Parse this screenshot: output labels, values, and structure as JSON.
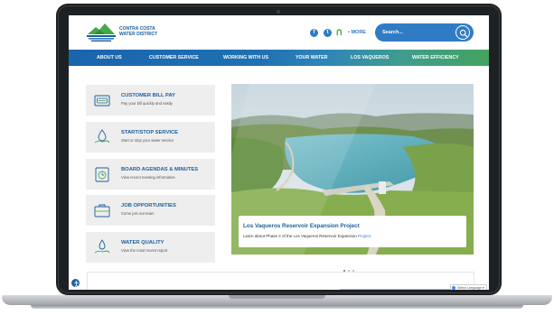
{
  "header": {
    "logo_line1": "CONTRA COSTA",
    "logo_line2": "WATER DISTRICT",
    "more_label": "• MORE",
    "search_placeholder": "Search..."
  },
  "nav": {
    "items": [
      "ABOUT US",
      "CUSTOMER SERVICE",
      "WORKING WITH US",
      "YOUR WATER",
      "LOS VAQUEROS",
      "WATER EFFICIENCY"
    ]
  },
  "cards": [
    {
      "title": "CUSTOMER BILL PAY",
      "subtitle": "Pay your bill quickly and easily",
      "icon": "bill-pay-icon"
    },
    {
      "title": "START/STOP SERVICE",
      "subtitle": "Start or stop your water service",
      "icon": "water-drop-hand-icon"
    },
    {
      "title": "BOARD AGENDAS & MINUTES",
      "subtitle": "View recent meeting information",
      "icon": "agenda-timer-icon"
    },
    {
      "title": "JOB OPPORTUNITIES",
      "subtitle": "Come join our team",
      "icon": "briefcase-icon"
    },
    {
      "title": "WATER QUALITY",
      "subtitle": "View the most recent report",
      "icon": "water-quality-hand-icon"
    }
  ],
  "hero": {
    "title": "Los Vaqueros Reservoir Expansion Project",
    "text": "Learn about Phase 2 of the Los Vaqueros Reservoir Expansion",
    "text_link": "Project."
  },
  "carousel": {
    "slides": 3,
    "active": 1
  },
  "translate": {
    "label": "Select Language"
  },
  "colors": {
    "brand_blue": "#1d5e9b",
    "accent_blue": "#2f7cc5",
    "accent_green": "#45a84a",
    "card_bg": "#eeeeee"
  }
}
